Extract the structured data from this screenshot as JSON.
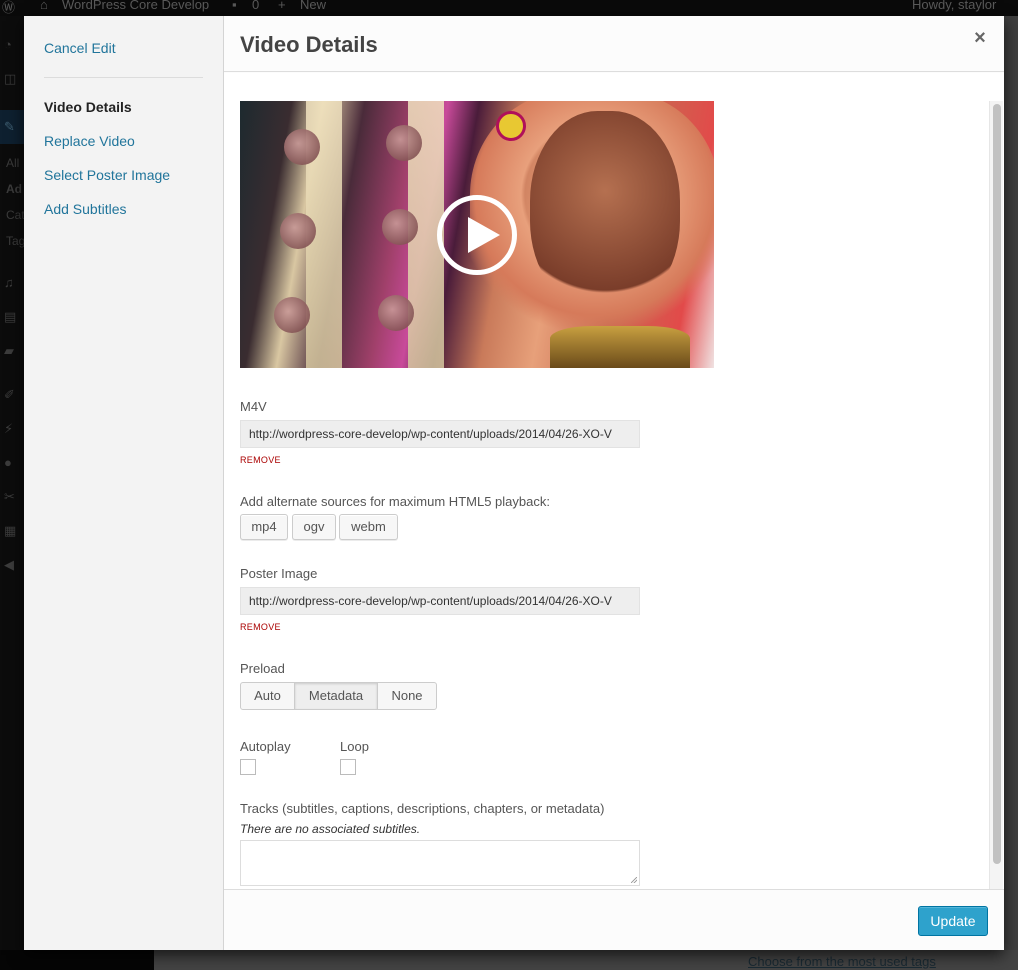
{
  "admin_bar": {
    "site_name": "WordPress Core Develop",
    "comments_count": "0",
    "new_label": "New",
    "greeting": "Howdy, staylor"
  },
  "admin_menu": {
    "visible_text": [
      "All",
      "Ad",
      "Cat",
      "Tag"
    ]
  },
  "background": {
    "tags_link": "Choose from the most used tags"
  },
  "modal": {
    "menu": {
      "cancel_edit": "Cancel Edit",
      "items": [
        {
          "label": "Video Details",
          "active": true
        },
        {
          "label": "Replace Video",
          "active": false
        },
        {
          "label": "Select Poster Image",
          "active": false
        },
        {
          "label": "Add Subtitles",
          "active": false
        }
      ]
    },
    "title": "Video Details",
    "close_icon": "×",
    "video": {
      "play_icon": "play-circle"
    },
    "m4v": {
      "label": "M4V",
      "value": "http://wordpress-core-develop/wp-content/uploads/2014/04/26-XO-V",
      "remove_label": "REMOVE"
    },
    "alternate_sources": {
      "label": "Add alternate sources for maximum HTML5 playback:",
      "buttons": [
        "mp4",
        "ogv",
        "webm"
      ]
    },
    "poster": {
      "label": "Poster Image",
      "value": "http://wordpress-core-develop/wp-content/uploads/2014/04/26-XO-V",
      "remove_label": "REMOVE"
    },
    "preload": {
      "label": "Preload",
      "options": [
        "Auto",
        "Metadata",
        "None"
      ],
      "selected": "Metadata"
    },
    "autoplay": {
      "label": "Autoplay",
      "checked": false
    },
    "loop": {
      "label": "Loop",
      "checked": false
    },
    "tracks": {
      "label": "Tracks (subtitles, captions, descriptions, chapters, or metadata)",
      "empty_note": "There are no associated subtitles.",
      "value": ""
    },
    "update_label": "Update"
  },
  "colors": {
    "link": "#21759b",
    "primary_button": "#2ea2cc",
    "remove": "#aa0000"
  }
}
